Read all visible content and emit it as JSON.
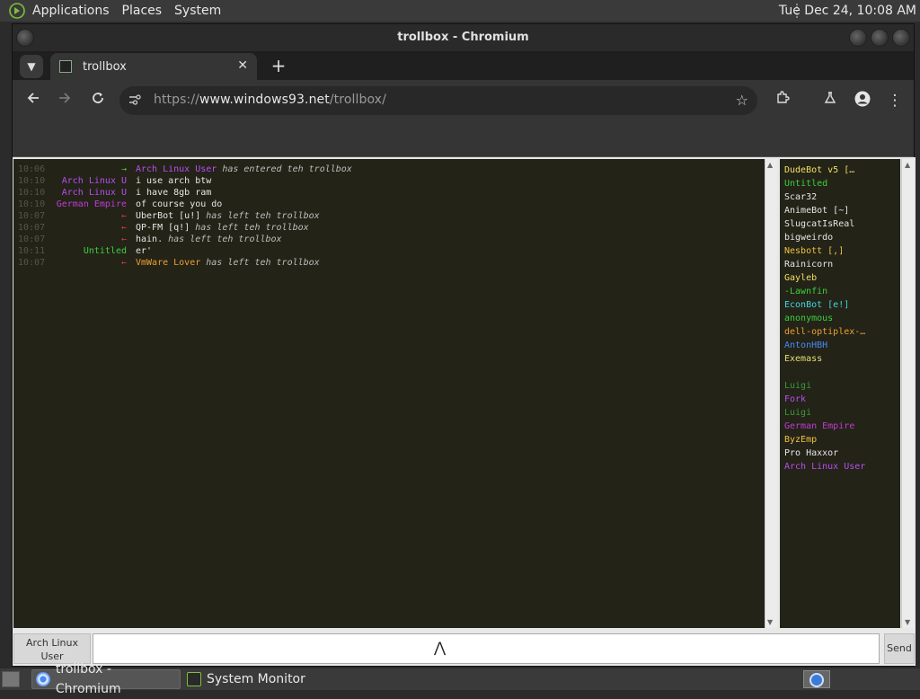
{
  "top_panel": {
    "menu": [
      "Applications",
      "Places",
      "System"
    ],
    "clock": "Tue Dec 24, 10:08 AM"
  },
  "window": {
    "title": "trollbox - Chromium"
  },
  "browser": {
    "tab_title": "trollbox",
    "url_scheme": "https://",
    "url_host": "www.windows93.net",
    "url_path": "/trollbox/"
  },
  "chat": {
    "messages": [
      {
        "time": "10:06",
        "nick": "→",
        "nick_color": "#3ccf3c",
        "text_user": "Arch Linux User",
        "user_color": "#b84ef0",
        "text": " has entered teh trollbox",
        "system": true
      },
      {
        "time": "10:10",
        "nick": "Arch Linux U",
        "nick_color": "#b84ef0",
        "text": "i use arch btw",
        "system": false
      },
      {
        "time": "10:10",
        "nick": "Arch Linux U",
        "nick_color": "#b84ef0",
        "text": "i have 8gb ram",
        "system": false
      },
      {
        "time": "10:10",
        "nick": "German Empire",
        "nick_color": "#c23bd4",
        "text": "of course you do",
        "system": false
      },
      {
        "time": "10:07",
        "nick": "←",
        "nick_color": "#e03a3a",
        "text_user": "UberBot [u!]",
        "user_color": "#e6e6e6",
        "text": " has left teh trollbox",
        "system": true
      },
      {
        "time": "10:07",
        "nick": "←",
        "nick_color": "#e03a3a",
        "text_user": "QP-FM [q!]",
        "user_color": "#e6e6e6",
        "text": " has left teh trollbox",
        "system": true
      },
      {
        "time": "10:07",
        "nick": "←",
        "nick_color": "#e03a3a",
        "text_user": "hain.",
        "user_color": "#e6e6e6",
        "text": " has left teh trollbox",
        "system": true
      },
      {
        "time": "10:11",
        "nick": "Untitled",
        "nick_color": "#3ccf3c",
        "text": "er'",
        "system": false
      },
      {
        "time": "10:07",
        "nick": "←",
        "nick_color": "#e03a3a",
        "text_user": "VmWare Lover",
        "user_color": "#f0a030",
        "text": " has left teh trollbox",
        "system": true
      }
    ]
  },
  "users": [
    {
      "name": "DudeBot  v5 […",
      "color": "#f0e060"
    },
    {
      "name": "Untitled",
      "color": "#3ccf3c"
    },
    {
      "name": "Scar32",
      "color": "#e6e6e6"
    },
    {
      "name": "AnimeBot  [~]",
      "color": "#e6e6e6"
    },
    {
      "name": "SlugcatIsReal",
      "color": "#e6e6e6"
    },
    {
      "name": "bigweirdo",
      "color": "#e6e6e6"
    },
    {
      "name": "Nesbott [,]",
      "color": "#f0c040"
    },
    {
      "name": " Rainicorn",
      "color": "#e6e6e6"
    },
    {
      "name": "Gayleb",
      "color": "#f0e060"
    },
    {
      "name": "-Lawnfin",
      "color": "#3ccf3c"
    },
    {
      "name": "EconBot [e!]",
      "color": "#40d8e0"
    },
    {
      "name": "anonymous",
      "color": "#3ccf3c"
    },
    {
      "name": "dell-optiplex-…",
      "color": "#f0a030"
    },
    {
      "name": "AntonHBH",
      "color": "#4a8af0"
    },
    {
      "name": " Exemass ",
      "color": "#e0e070"
    },
    {
      "name": "",
      "color": "#6a2ad0"
    },
    {
      "name": "Luigi",
      "color": "#3a9a3a"
    },
    {
      "name": "Fork",
      "color": "#b84ef0"
    },
    {
      "name": "Luigi",
      "color": "#3a9a3a"
    },
    {
      "name": "German Empire",
      "color": "#c23bd4"
    },
    {
      "name": "ByzEmp",
      "color": "#f0c040"
    },
    {
      "name": "Pro Haxxor",
      "color": "#e6e6e6"
    },
    {
      "name": "Arch Linux User",
      "color": "#b84ef0"
    }
  ],
  "input": {
    "nick_button": "Arch Linux User",
    "send_button": "Send",
    "value": ""
  },
  "taskbar": {
    "tasks": [
      "trollbox - Chromium",
      "System Monitor"
    ]
  }
}
